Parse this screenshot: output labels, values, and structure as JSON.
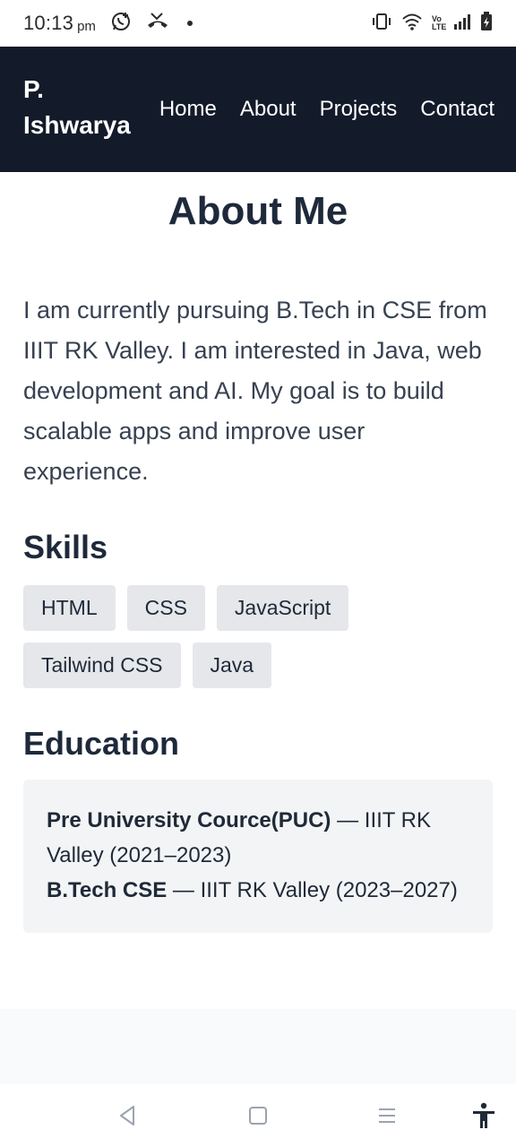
{
  "status_bar": {
    "time": "10:13",
    "ampm": "pm",
    "icons": [
      "whatsapp-icon",
      "missed-call-icon",
      "notification-dot",
      "vibrate-icon",
      "wifi-icon",
      "volte-icon",
      "signal-icon",
      "battery-icon"
    ],
    "volte_label": "Vo\nLTE"
  },
  "nav": {
    "brand": "P. Ishwarya",
    "links": [
      "Home",
      "About",
      "Projects",
      "Contact"
    ]
  },
  "about": {
    "title": "About Me",
    "intro": "I am currently pursuing B.Tech in CSE from IIIT RK Valley. I am interested in Java, web development and AI. My goal is to build scalable apps and improve user experience."
  },
  "skills": {
    "title": "Skills",
    "items": [
      "HTML",
      "CSS",
      "JavaScript",
      "Tailwind CSS",
      "Java"
    ]
  },
  "education": {
    "title": "Education",
    "entries": [
      {
        "degree": "Pre University Cource(PUC)",
        "detail": " — IIIT RK Valley (2021–2023)"
      },
      {
        "degree": "B.Tech CSE",
        "detail": " — IIIT RK Valley (2023–2027)"
      }
    ]
  },
  "system_nav": {
    "buttons": [
      "back-icon",
      "home-icon",
      "recents-icon",
      "accessibility-icon"
    ]
  },
  "colors": {
    "navbar_bg": "#131a2a",
    "heading": "#1e293b",
    "chip_bg": "#e5e7eb",
    "card_bg": "#f3f4f6"
  }
}
